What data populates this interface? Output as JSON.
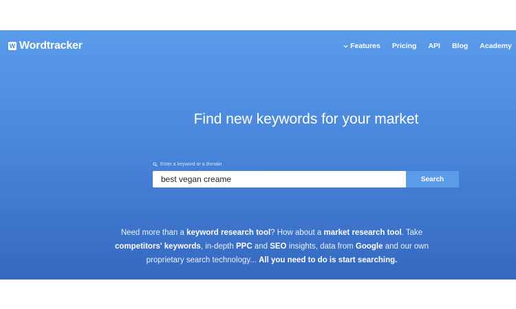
{
  "brand": {
    "logo_letter": "W",
    "name": "Wordtracker"
  },
  "nav": {
    "items": [
      {
        "label": "Features",
        "has_dropdown": true,
        "icon": "chevron-down-icon"
      },
      {
        "label": "Pricing"
      },
      {
        "label": "API"
      },
      {
        "label": "Blog"
      },
      {
        "label": "Academy"
      }
    ]
  },
  "hero": {
    "headline": "Find new keywords for your market",
    "search": {
      "hint": "Enter a keyword or a domain",
      "hint_icon": "search-icon",
      "value": "best vegan creame",
      "button_label": "Search"
    },
    "description": {
      "parts": [
        "Need more than a ",
        "keyword research tool",
        "? How about a ",
        "market research tool",
        ". Take ",
        "competitors'",
        " ",
        "keywords",
        ", in-depth ",
        "PPC",
        " and ",
        "SEO",
        " insights, data from ",
        "Google",
        " and our own proprietary search technology... ",
        "All you need to do is start searching."
      ]
    }
  },
  "colors": {
    "hero_top": "#5a9bea",
    "hero_bottom": "#3568c0",
    "button": "#5b9be8"
  }
}
